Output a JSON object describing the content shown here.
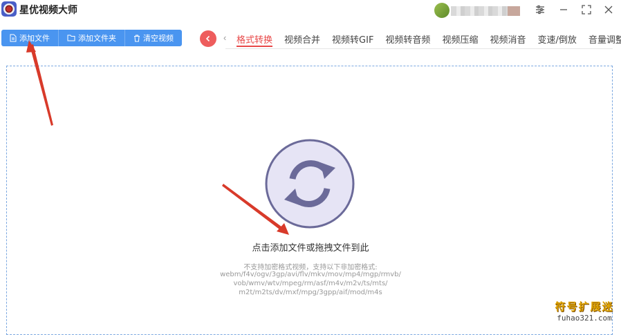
{
  "app": {
    "title": "星优视频大师"
  },
  "window": {
    "controls": [
      "settings-icon",
      "minimize-icon",
      "maximize-icon",
      "close-icon"
    ]
  },
  "toolbar": {
    "add_file": "添加文件",
    "add_folder": "添加文件夹",
    "clear": "清空视频",
    "color": "#4a95f0"
  },
  "tabs": [
    {
      "label": "格式转换",
      "active": true
    },
    {
      "label": "视频合并"
    },
    {
      "label": "视频转GIF"
    },
    {
      "label": "视频转音频"
    },
    {
      "label": "视频压缩"
    },
    {
      "label": "视频消音"
    },
    {
      "label": "变速/倒放"
    },
    {
      "label": "音量调整"
    }
  ],
  "drop_zone": {
    "title": "点击添加文件或拖拽文件到此",
    "hint_lines": [
      "不支持加密格式视频，支持以下非加密格式:",
      "webm/f4v/ogv/3gp/avi/flv/mkv/mov/mp4/mgp/rmvb/",
      "vob/wmv/wtv/mpeg/rm/asf/m4v/m2v/ts/mts/",
      "m2t/m2ts/dv/mxf/mpg/3gpp/aif/mod/m4s"
    ]
  },
  "watermark": {
    "cn": "符号扩展迷",
    "en": "fuhao321.com"
  },
  "colors": {
    "accent": "#e84848",
    "circle_fill": "#e6e4f5",
    "circle_stroke": "#6b6a99",
    "arrow": "#d83a2a"
  }
}
